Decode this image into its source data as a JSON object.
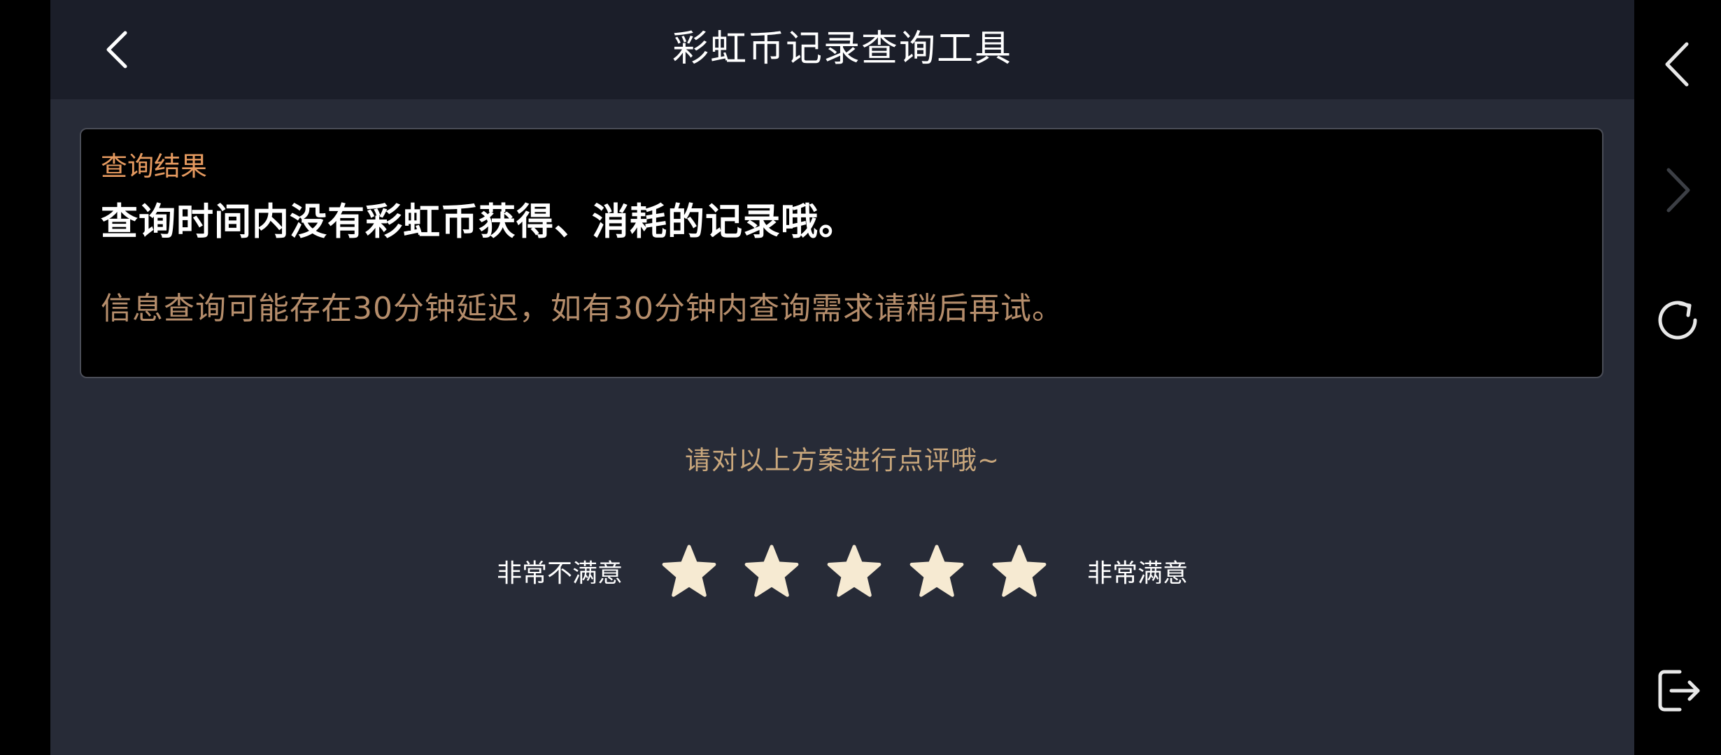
{
  "header": {
    "title": "彩虹币记录查询工具",
    "back_icon": "chevron-left-icon"
  },
  "result": {
    "label": "查询结果",
    "message": "查询时间内没有彩虹币获得、消耗的记录哦。",
    "note": "信息查询可能存在30分钟延迟，如有30分钟内查询需求请稍后再试。"
  },
  "rating": {
    "prompt": "请对以上方案进行点评哦~",
    "min_label": "非常不满意",
    "max_label": "非常满意",
    "star_count": 5,
    "selected": 0
  },
  "side_nav": {
    "back_icon": "chevron-left-icon",
    "forward_icon": "chevron-right-icon",
    "refresh_icon": "refresh-icon",
    "exit_icon": "exit-icon"
  },
  "colors": {
    "background": "#272b37",
    "header_background": "#1b1e29",
    "result_label": "#e59a60",
    "result_note": "#b58d6b",
    "rate_prompt": "#c9a77c",
    "star_fill": "#f6ead2"
  }
}
